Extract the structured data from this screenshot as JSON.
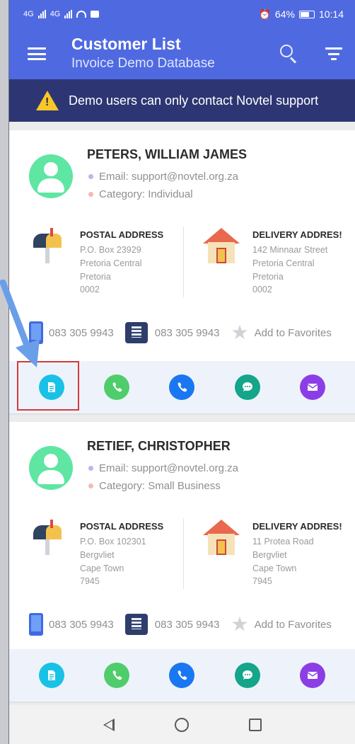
{
  "status": {
    "signal_left": "4G",
    "signal_right": "4G",
    "alarm_icon": "alarm-icon",
    "battery": "64%",
    "time": "10:14"
  },
  "appbar": {
    "title": "Customer List",
    "subtitle": "Invoice Demo Database"
  },
  "banner": {
    "text": "Demo users can only contact Novtel support"
  },
  "customers": [
    {
      "name": "PETERS, WILLIAM JAMES",
      "email": "Email: support@novtel.org.za",
      "category": "Category: Individual",
      "postal": {
        "label": "POSTAL ADDRESS",
        "lines": [
          "P.O. Box 23929",
          "Pretoria Central",
          "Pretoria",
          "0002"
        ]
      },
      "delivery": {
        "label": "DELIVERY ADDRES!",
        "lines": [
          "142 Minnaar Street",
          "Pretoria Central",
          "Pretoria",
          "0002"
        ]
      },
      "mobile": "083 305 9943",
      "landline": "083 305 9943",
      "favorite": "Add to Favorites"
    },
    {
      "name": "RETIEF, CHRISTOPHER",
      "email": "Email: support@novtel.org.za",
      "category": "Category: Small Business",
      "postal": {
        "label": "POSTAL ADDRESS",
        "lines": [
          "P.O. Box 102301",
          "Bergvliet",
          "Cape Town",
          "7945"
        ]
      },
      "delivery": {
        "label": "DELIVERY ADDRES!",
        "lines": [
          "11 Protea Road",
          "Bergvliet",
          "Cape Town",
          "7945"
        ]
      },
      "mobile": "083 305 9943",
      "landline": "083 305 9943",
      "favorite": "Add to Favorites"
    }
  ],
  "colors": {
    "primary": "#4f6ae0",
    "banner": "#2d3673",
    "doc": "#19c1e6",
    "call": "#4fcd6a",
    "phone": "#1a77f2",
    "chat": "#14a58b",
    "mail": "#8c3ee6",
    "highlight": "#d43a3a"
  }
}
